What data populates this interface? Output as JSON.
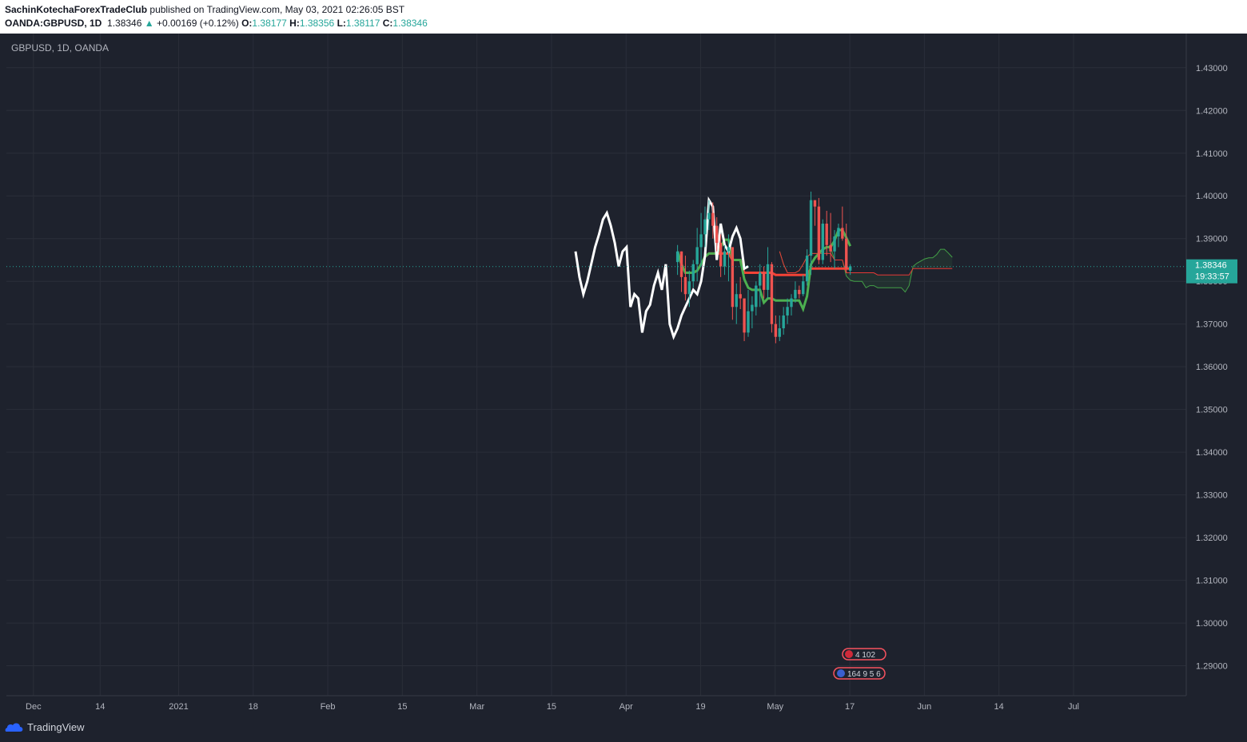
{
  "header": {
    "author": "SachinKotechaForexTradeClub",
    "published_text": "published on TradingView.com, May 03, 2021 02:26:05 BST",
    "symbol": "OANDA:GBPUSD, 1D",
    "last": "1.38346",
    "change": "+0.00169 (+0.12%)",
    "o_label": "O:",
    "o": "1.38177",
    "h_label": "H:",
    "h": "1.38356",
    "l_label": "L:",
    "l": "1.38117",
    "c_label": "C:",
    "c": "1.38346"
  },
  "chart_label": "GBPUSD, 1D, OANDA",
  "price_tag": {
    "price": "1.38346",
    "countdown": "19:33:57"
  },
  "footer": {
    "brand": "TradingView"
  },
  "events": {
    "row1": "4 102",
    "row2": "164 9 5 6"
  },
  "colors": {
    "up": "#26a69a",
    "down": "#ef5350",
    "tenkan": "#4caf50",
    "kijun": "#f44336",
    "chikou": "#ffffff",
    "span_a": "#43a047",
    "span_b": "#e53935",
    "background": "#1e222d"
  },
  "chart_data": {
    "type": "candlestick",
    "title": "GBPUSD, 1D, OANDA",
    "ylim": [
      1.283,
      1.438
    ],
    "y_ticks": [
      "1.43000",
      "1.42000",
      "1.41000",
      "1.40000",
      "1.39000",
      "1.38000",
      "1.37000",
      "1.36000",
      "1.35000",
      "1.34000",
      "1.33000",
      "1.32000",
      "1.31000",
      "1.30000",
      "1.29000"
    ],
    "x_ticks": [
      "Dec",
      "14",
      "2021",
      "18",
      "Feb",
      "15",
      "Mar",
      "15",
      "Apr",
      "19",
      "May",
      "17",
      "Jun",
      "14",
      "Jul"
    ],
    "x_tick_index": [
      2,
      19,
      39,
      58,
      77,
      96,
      115,
      134,
      153,
      172,
      191,
      210,
      229,
      248,
      267
    ],
    "candles": [
      [
        1.3845,
        1.3885,
        1.3815,
        1.387
      ],
      [
        1.387,
        1.387,
        1.3775,
        1.381
      ],
      [
        1.381,
        1.386,
        1.3755,
        1.377
      ],
      [
        1.377,
        1.3825,
        1.374,
        1.38
      ],
      [
        1.38,
        1.385,
        1.3785,
        1.384
      ],
      [
        1.384,
        1.3925,
        1.38,
        1.388
      ],
      [
        1.388,
        1.396,
        1.3835,
        1.391
      ],
      [
        1.391,
        1.3975,
        1.388,
        1.3945
      ],
      [
        1.3945,
        1.399,
        1.392,
        1.396
      ],
      [
        1.396,
        1.3985,
        1.39,
        1.393
      ],
      [
        1.393,
        1.395,
        1.387,
        1.389
      ],
      [
        1.389,
        1.391,
        1.381,
        1.3835
      ],
      [
        1.3835,
        1.3885,
        1.3815,
        1.387
      ],
      [
        1.387,
        1.391,
        1.38,
        1.388
      ],
      [
        1.388,
        1.388,
        1.371,
        1.374
      ],
      [
        1.374,
        1.3795,
        1.37,
        1.377
      ],
      [
        1.377,
        1.381,
        1.3735,
        1.376
      ],
      [
        1.376,
        1.376,
        1.366,
        1.368
      ],
      [
        1.368,
        1.378,
        1.367,
        1.373
      ],
      [
        1.373,
        1.3765,
        1.369,
        1.3745
      ],
      [
        1.374,
        1.38,
        1.372,
        1.379
      ],
      [
        1.379,
        1.384,
        1.374,
        1.382
      ],
      [
        1.382,
        1.3835,
        1.376,
        1.378
      ],
      [
        1.378,
        1.388,
        1.376,
        1.384
      ],
      [
        1.384,
        1.3845,
        1.368,
        1.37
      ],
      [
        1.37,
        1.372,
        1.3655,
        1.367
      ],
      [
        1.367,
        1.372,
        1.366,
        1.369
      ],
      [
        1.369,
        1.374,
        1.3675,
        1.372
      ],
      [
        1.372,
        1.376,
        1.37,
        1.374
      ],
      [
        1.374,
        1.377,
        1.372,
        1.376
      ],
      [
        1.376,
        1.38,
        1.375,
        1.378
      ],
      [
        1.378,
        1.379,
        1.376,
        1.377
      ],
      [
        1.377,
        1.3815,
        1.3765,
        1.38
      ],
      [
        1.38,
        1.3875,
        1.379,
        1.386
      ],
      [
        1.386,
        1.401,
        1.3815,
        1.399
      ],
      [
        1.399,
        1.399,
        1.393,
        1.3975
      ],
      [
        1.3975,
        1.3995,
        1.384,
        1.385
      ],
      [
        1.385,
        1.3945,
        1.384,
        1.3935
      ],
      [
        1.3935,
        1.3965,
        1.386,
        1.3885
      ],
      [
        1.3885,
        1.396,
        1.3845,
        1.387
      ],
      [
        1.387,
        1.392,
        1.383,
        1.3905
      ],
      [
        1.3905,
        1.3935,
        1.388,
        1.3925
      ],
      [
        1.3925,
        1.3975,
        1.3895,
        1.39
      ],
      [
        1.39,
        1.3935,
        1.382,
        1.383
      ],
      [
        1.3825,
        1.384,
        1.3815,
        1.3835
      ]
    ],
    "candle_index": [
      0,
      1,
      2,
      3,
      4,
      5,
      6,
      7,
      8,
      9,
      10,
      11,
      12,
      13,
      14,
      15,
      16,
      17,
      18,
      19,
      20,
      21,
      22,
      23,
      24,
      25,
      26,
      27,
      28,
      29,
      30,
      31,
      32,
      33,
      34,
      35,
      36,
      37,
      38,
      39,
      40,
      41,
      42,
      43,
      44
    ],
    "price_line": 1.38346
  }
}
